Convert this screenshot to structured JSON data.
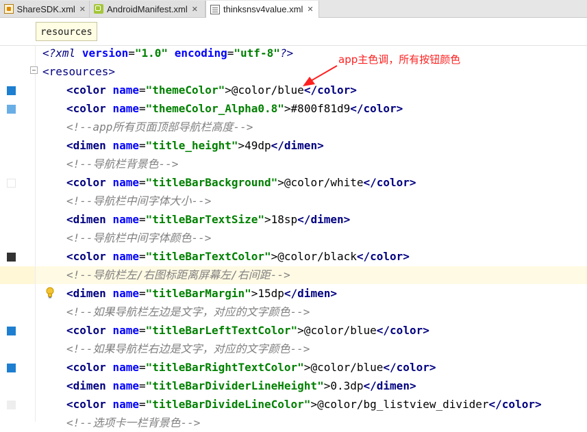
{
  "tabs": [
    {
      "label": "ShareSDK.xml",
      "icon": "xml-file-icon",
      "close": "✕",
      "active": false
    },
    {
      "label": "AndroidManifest.xml",
      "icon": "android-manifest-icon",
      "close": "✕",
      "active": false
    },
    {
      "label": "thinksnsv4value.xml",
      "icon": "values-file-icon",
      "close": "✕",
      "active": true
    }
  ],
  "breadcrumb": "resources",
  "annotation": "app主色调，所有按钮颜色",
  "colors": {
    "annotation": "#ff2020",
    "caret_line": "#fffae3",
    "tag": "#000080",
    "attribute": "#0000ff",
    "value": "#008000",
    "comment": "#808080"
  },
  "gutter_swatches": [
    {
      "line": "themeColor",
      "color": "#1e7fd0"
    },
    {
      "line": "themeColor_Alpha0.8",
      "color": "#6aaee6"
    },
    {
      "line": "titleBarBackground",
      "color": "#ffffff"
    },
    {
      "line": "titleBarTextColor",
      "color": "#333333"
    },
    {
      "line": "titleBarLeftTextColor",
      "color": "#1e7fd0"
    },
    {
      "line": "titleBarRightTextColor",
      "color": "#1e7fd0"
    },
    {
      "line": "titleBarDivideLineColor",
      "color": "#eeeeee"
    }
  ],
  "code": {
    "l1": {
      "open": "<?xml",
      "a1": "version",
      "eq1": "=",
      "v1": "\"1.0\"",
      "a2": "encoding",
      "eq2": "=",
      "v2": "\"utf-8\"",
      "close": "?>"
    },
    "l2": {
      "tag": "<resources>"
    },
    "l3": {
      "open": "<color",
      "attr": "name",
      "eq": "=",
      "val": "\"themeColor\"",
      "gt": ">",
      "text": "@color/blue",
      "close": "</color>"
    },
    "l4": {
      "open": "<color",
      "attr": "name",
      "eq": "=",
      "val": "\"themeColor_Alpha0.8\"",
      "gt": ">",
      "text": "#800f81d9",
      "close": "</color>"
    },
    "l5": {
      "comment": "<!--app所有页面顶部导航栏高度-->"
    },
    "l6": {
      "open": "<dimen",
      "attr": "name",
      "eq": "=",
      "val": "\"title_height\"",
      "gt": ">",
      "text": "49dp",
      "close": "</dimen>"
    },
    "l7": {
      "comment": "<!--导航栏背景色-->"
    },
    "l8": {
      "open": "<color",
      "attr": "name",
      "eq": "=",
      "val": "\"titleBarBackground\"",
      "gt": ">",
      "text": "@color/white",
      "close": "</color>"
    },
    "l9": {
      "comment": "<!--导航栏中间字体大小-->"
    },
    "l10": {
      "open": "<dimen",
      "attr": "name",
      "eq": "=",
      "val": "\"titleBarTextSize\"",
      "gt": ">",
      "text": "18sp",
      "close": "</dimen>"
    },
    "l11": {
      "comment": "<!--导航栏中间字体颜色-->"
    },
    "l12": {
      "open": "<color",
      "attr": "name",
      "eq": "=",
      "val": "\"titleBarTextColor\"",
      "gt": ">",
      "text": "@color/black",
      "close": "</color>"
    },
    "l13": {
      "comment": "<!--导航栏左/右图标距离屏幕左/右间距-->"
    },
    "l14": {
      "open": "<dimen",
      "attr": "name",
      "eq": "=",
      "val": "\"titleBarMargin\"",
      "gt": ">",
      "text": "15dp",
      "close": "</dimen>"
    },
    "l15": {
      "comment": "<!--如果导航栏左边是文字，对应的文字颜色-->"
    },
    "l16": {
      "open": "<color",
      "attr": "name",
      "eq": "=",
      "val": "\"titleBarLeftTextColor\"",
      "gt": ">",
      "text": "@color/blue",
      "close": "</color>"
    },
    "l17": {
      "comment": "<!--如果导航栏右边是文字，对应的文字颜色-->"
    },
    "l18": {
      "open": "<color",
      "attr": "name",
      "eq": "=",
      "val": "\"titleBarRightTextColor\"",
      "gt": ">",
      "text": "@color/blue",
      "close": "</color>"
    },
    "l19": {
      "open": "<dimen",
      "attr": "name",
      "eq": "=",
      "val": "\"titleBarDividerLineHeight\"",
      "gt": ">",
      "text": "0.3dp",
      "close": "</dimen>"
    },
    "l20": {
      "open": "<color",
      "attr": "name",
      "eq": "=",
      "val": "\"titleBarDivideLineColor\"",
      "gt": ">",
      "text": "@color/bg_listview_divider",
      "close": "</color>"
    },
    "l21": {
      "comment": "<!--选项卡一栏背景色-->"
    }
  }
}
